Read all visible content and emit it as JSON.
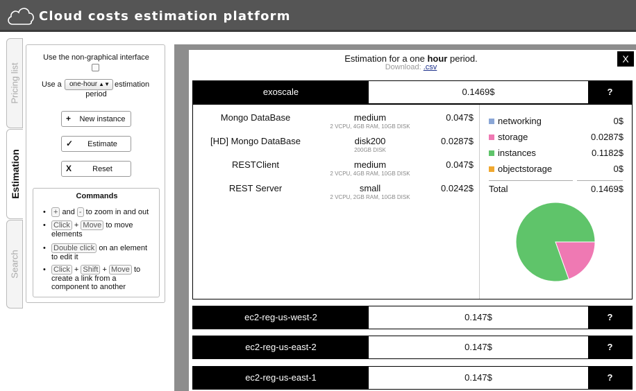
{
  "header": {
    "title": "Cloud costs estimation platform"
  },
  "tabs": [
    {
      "label": "Pricing list"
    },
    {
      "label": "Estimation"
    },
    {
      "label": "Search"
    }
  ],
  "panel": {
    "non_graphical_label": "Use the non-graphical interface",
    "use_a": "Use a",
    "period_value": "one-hour",
    "estimation_label": "estimation",
    "period_label": "period",
    "new_instance": "New instance",
    "estimate": "Estimate",
    "reset": "Reset",
    "commands": {
      "title": "Commands",
      "plus_key": "+",
      "and": "and",
      "minus_key": "-",
      "zoom_text": "to zoom in and out",
      "click_key": "Click",
      "plus_sep": "+",
      "move_key": "Move",
      "move_text": "to move elements",
      "double_click_key": "Double click",
      "edit_text": "on an element to edit it",
      "shift_key": "Shift",
      "link_text": "to create a link from a component to another"
    }
  },
  "modal": {
    "title_prefix": "Estimation for a one",
    "title_bold": "hour",
    "title_suffix": "period.",
    "download_label": "Download:",
    "download_link": ".csv",
    "close": "X"
  },
  "providers": [
    {
      "name": "exoscale",
      "cost": "0.1469$",
      "help": "?"
    },
    {
      "name": "ec2-reg-us-west-2",
      "cost": "0.147$",
      "help": "?"
    },
    {
      "name": "ec2-reg-us-east-2",
      "cost": "0.147$",
      "help": "?"
    },
    {
      "name": "ec2-reg-us-east-1",
      "cost": "0.147$",
      "help": "?"
    }
  ],
  "instances": [
    {
      "name": "Mongo DataBase",
      "size": "medium",
      "spec": "2 VCPU, 4GB RAM, 10GB DISK",
      "cost": "0.047$"
    },
    {
      "name": "[HD] Mongo DataBase",
      "size": "disk200",
      "spec": "200GB DISK",
      "cost": "0.0287$"
    },
    {
      "name": "RESTClient",
      "size": "medium",
      "spec": "2 VCPU, 4GB RAM, 10GB DISK",
      "cost": "0.047$"
    },
    {
      "name": "REST Server",
      "size": "small",
      "spec": "2 VCPU, 2GB RAM, 10GB DISK",
      "cost": "0.0242$"
    }
  ],
  "breakdown": [
    {
      "name": "networking",
      "value": "0$",
      "color": "#8aa6d6"
    },
    {
      "name": "storage",
      "value": "0.0287$",
      "color": "#ef79b3"
    },
    {
      "name": "instances",
      "value": "0.1182$",
      "color": "#5fc46a"
    },
    {
      "name": "objectstorage",
      "value": "0$",
      "color": "#f0a830"
    }
  ],
  "total": {
    "label": "Total",
    "value": "0.1469$"
  },
  "chart_data": {
    "type": "pie",
    "categories": [
      "networking",
      "storage",
      "instances",
      "objectstorage"
    ],
    "values": [
      0,
      0.0287,
      0.1182,
      0
    ],
    "colors": [
      "#8aa6d6",
      "#ef79b3",
      "#5fc46a",
      "#f0a830"
    ]
  }
}
